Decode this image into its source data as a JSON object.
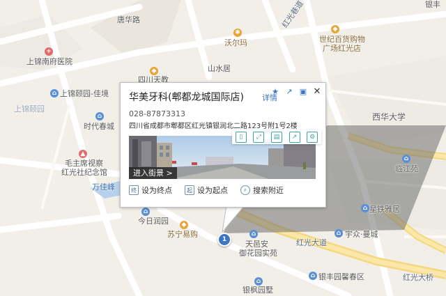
{
  "map_labels": {
    "tang_hua": "唐华路",
    "hong_guang_xiang": "红光巷道",
    "wo_er_ma": "沃尔玛",
    "shi_ji_bai_gou_1": "世纪百货购物",
    "shi_ji_bai_gou_2": "广场红光店",
    "shang_jin_nan_hospital": "上锦南府医院",
    "si_chuan_tian_jiao": "四川天教",
    "shan_shui": "山水居",
    "shang_jin_yuan": "上锦颐园-佳境",
    "shang_jin_yi_yuan": "上锦颐园",
    "shi_dai_chun_cheng": "时代春城",
    "xi_hua_da_xue": "西华大学",
    "mao_zhu_xi_1": "毛主席视察",
    "mao_zhu_xi_2": "红光社纪念馆",
    "wan_ji_feng": "万佳峰",
    "lin_jiang_yuan": "临江苑",
    "jin_ri_run_yuan": "今日润园",
    "su_ning": "苏宁易购",
    "xing_tie_ya_yuan": "星铁雅居",
    "yu_zhong_man_cheng": "宇众·曼城",
    "tian_chang_an_1": "天邑安",
    "tian_chang_an_2": "御花园实苑",
    "hong_guang_da_dao": "红光大道",
    "yin_feng_yuan": "银丰园馨春区",
    "hong_guang_da_qiao": "红光大桥",
    "yin_feng_xin": "银枫园墅",
    "top_right": "银丰"
  },
  "popup": {
    "title": "华美牙科(郫都龙城国际店)",
    "detail_link": "详情",
    "phone": "028-87873313",
    "address": "四川省成都市郫都区红光镇银润北二路123号附1号2楼",
    "street_view_label": "进入街景 >",
    "actions": {
      "set_end": "设为终点",
      "set_start": "设为起点",
      "search_nearby": "搜索附近"
    }
  },
  "marker": {
    "number": "1"
  }
}
